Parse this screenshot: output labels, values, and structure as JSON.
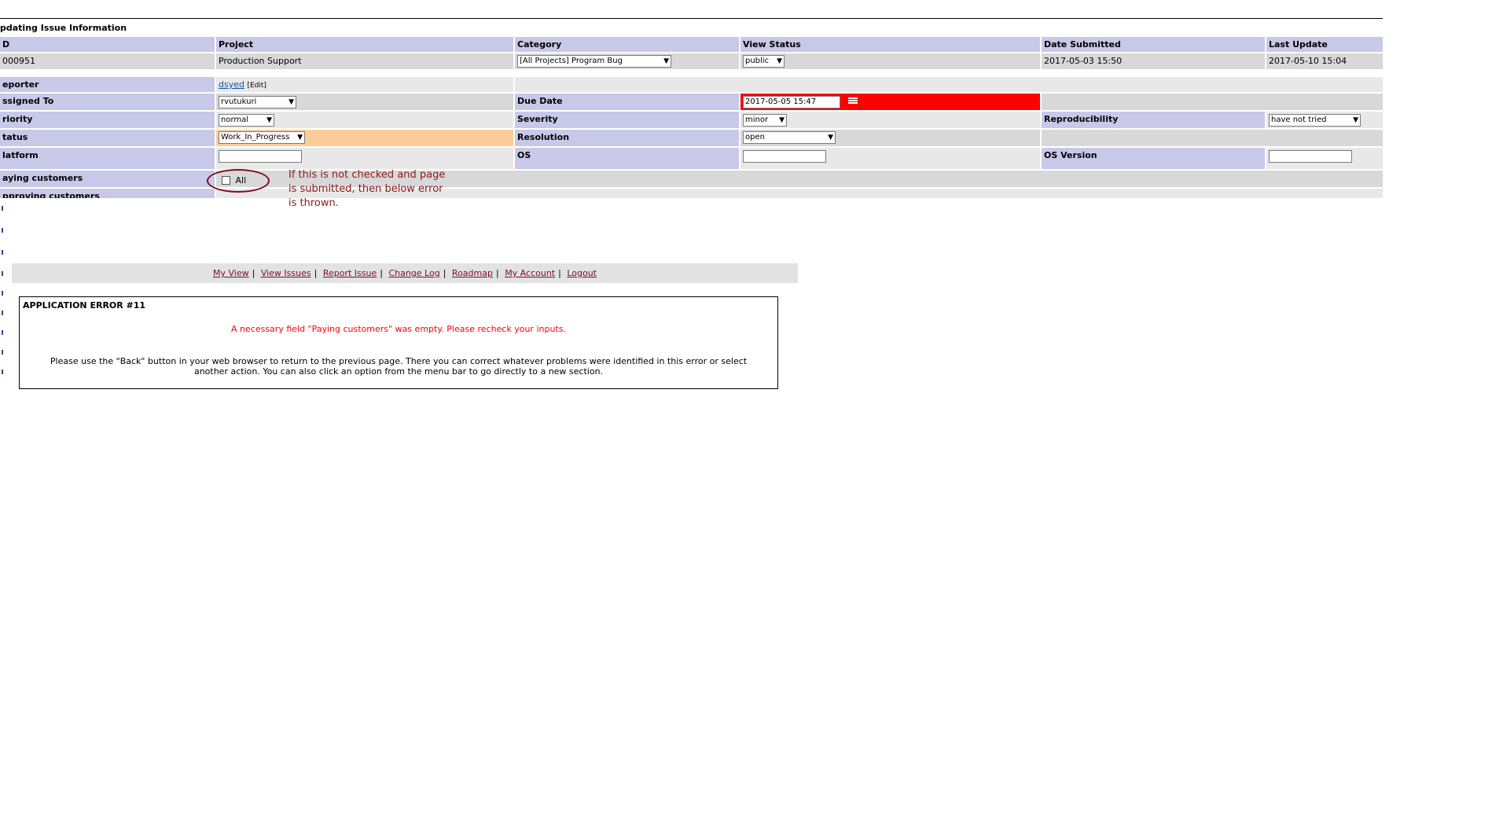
{
  "form": {
    "title": "pdating Issue Information",
    "headers": {
      "id": "D",
      "project": "Project",
      "category": "Category",
      "view_status": "View Status",
      "date_submitted": "Date Submitted",
      "last_update": "Last Update"
    },
    "values": {
      "id": "000951",
      "project": "Production Support",
      "category": "[All Projects] Program Bug",
      "view_status": "public",
      "date_submitted": "2017-05-03 15:50",
      "last_update": "2017-05-10 15:04"
    },
    "reporter": {
      "label": "eporter",
      "value": "dsyed",
      "edit": "[Edit]"
    },
    "assigned_to": {
      "label": "ssigned To",
      "value": "rvutukuri"
    },
    "due_date": {
      "label": "Due Date",
      "value": "2017-05-05 15:47"
    },
    "priority": {
      "label": "riority",
      "value": "normal"
    },
    "severity": {
      "label": "Severity",
      "value": "minor"
    },
    "reproducibility": {
      "label": "Reproducibility",
      "value": "have not tried"
    },
    "status": {
      "label": "tatus",
      "value": "Work_In_Progress"
    },
    "resolution": {
      "label": "Resolution",
      "value": "open"
    },
    "platform": {
      "label": "latform",
      "value": ""
    },
    "os": {
      "label": "OS",
      "value": ""
    },
    "os_version": {
      "label": "OS Version",
      "value": ""
    },
    "paying_customers": {
      "label": "aying customers",
      "option": "All",
      "checked": false
    },
    "approving_customers": {
      "label": "pproving customers"
    }
  },
  "annotation": {
    "text": "If this is not checked and page is submitted, then below error is thrown.",
    "color": "#8b1a1a"
  },
  "menu": {
    "items": [
      "My View",
      "View Issues",
      "Report Issue",
      "Change Log",
      "Roadmap",
      "My Account",
      "Logout"
    ],
    "separator": "|"
  },
  "error": {
    "title": "APPLICATION ERROR #11",
    "message": "A necessary field \"Paying customers\" was empty. Please recheck your inputs.",
    "help": "Please use the \"Back\" button in your web browser to return to the previous page. There you can correct whatever problems were identified in this error or select another action. You can also click an option from the menu bar to go directly to a new section."
  },
  "colors": {
    "header_bg": "#c8c8e8",
    "row_bg_dark": "#d8d8d8",
    "row_bg_light": "#e8e8e8",
    "status_bg": "#ffcc99",
    "due_date_bg": "#ff0000",
    "error_text": "#ff0000",
    "menu_link": "#7a0c2a"
  },
  "icons": {
    "calendar": "calendar-icon",
    "checkbox": "checkbox-icon"
  }
}
